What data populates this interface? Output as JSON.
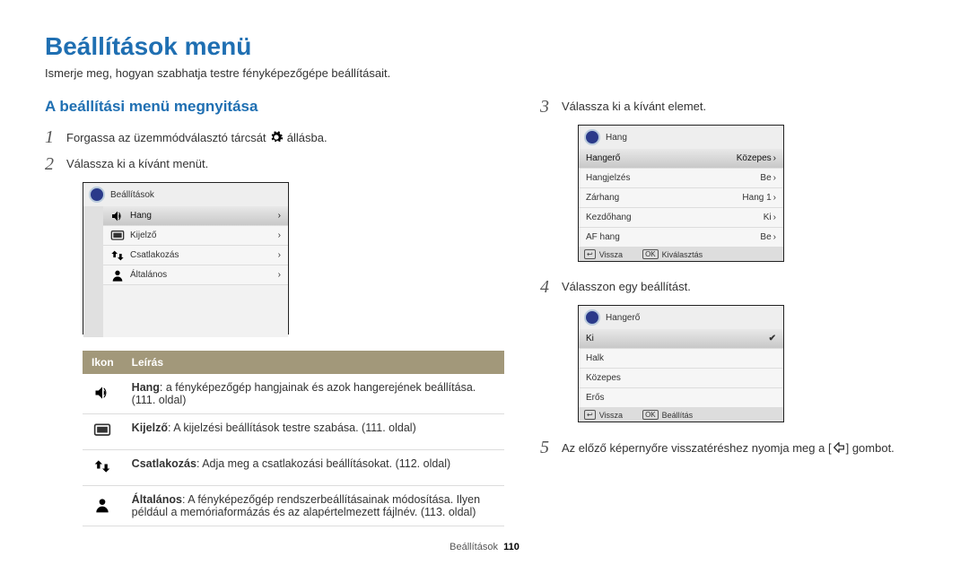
{
  "page_title": "Beállítások menü",
  "subtitle": "Ismerje meg, hogyan szabhatja testre fényképezőgépe beállításait.",
  "section_title": "A beállítási menü megnyitása",
  "step1": {
    "num": "1",
    "text_prefix": "Forgassa az üzemmódválasztó tárcsát ",
    "text_suffix": " állásba."
  },
  "step2": {
    "num": "2",
    "text": "Válassza ki a kívánt menüt."
  },
  "step3": {
    "num": "3",
    "text": "Válassza ki a kívánt elemet."
  },
  "step4": {
    "num": "4",
    "text": "Válasszon egy beállítást."
  },
  "step5": {
    "num": "5",
    "text_prefix": "Az előző képernyőre visszatéréshez nyomja meg a [",
    "text_suffix": "] gombot."
  },
  "panel1": {
    "title": "Beállítások",
    "rows": [
      {
        "icon": "speaker",
        "label": "Hang",
        "highlight": true
      },
      {
        "icon": "display",
        "label": "Kijelző"
      },
      {
        "icon": "transfer",
        "label": "Csatlakozás"
      },
      {
        "icon": "person",
        "label": "Általános"
      }
    ]
  },
  "panel2": {
    "title": "Hang",
    "rows": [
      {
        "label": "Hangerő",
        "value": "Közepes",
        "highlight": true
      },
      {
        "label": "Hangjelzés",
        "value": "Be"
      },
      {
        "label": "Zárhang",
        "value": "Hang 1"
      },
      {
        "label": "Kezdőhang",
        "value": "Ki"
      },
      {
        "label": "AF hang",
        "value": "Be"
      }
    ],
    "footer": {
      "back_icon": "↩",
      "back_label": "Vissza",
      "ok_icon": "OK",
      "ok_label": "Kiválasztás"
    }
  },
  "panel3": {
    "title": "Hangerő",
    "rows": [
      {
        "label": "Ki",
        "selected": true
      },
      {
        "label": "Halk"
      },
      {
        "label": "Közepes"
      },
      {
        "label": "Erős"
      }
    ],
    "footer": {
      "back_icon": "↩",
      "back_label": "Vissza",
      "ok_icon": "OK",
      "ok_label": "Beállítás"
    }
  },
  "desc_table": {
    "headers": [
      "Ikon",
      "Leírás"
    ],
    "rows": [
      {
        "icon": "speaker",
        "title": "Hang",
        "text": ": a fényképezőgép hangjainak és azok hangerejének beállítása. (111. oldal)"
      },
      {
        "icon": "display",
        "title": "Kijelző",
        "text": ": A kijelzési beállítások testre szabása. (111. oldal)"
      },
      {
        "icon": "transfer",
        "title": "Csatlakozás",
        "text": ": Adja meg a csatlakozási beállításokat. (112. oldal)"
      },
      {
        "icon": "person",
        "title": "Általános",
        "text": ": A fényképezőgép rendszerbeállításainak módosítása. Ilyen például a memóriaformázás és az alapértelmezett fájlnév. (113. oldal)"
      }
    ]
  },
  "footer": {
    "label": "Beállítások",
    "page_num": "110"
  }
}
